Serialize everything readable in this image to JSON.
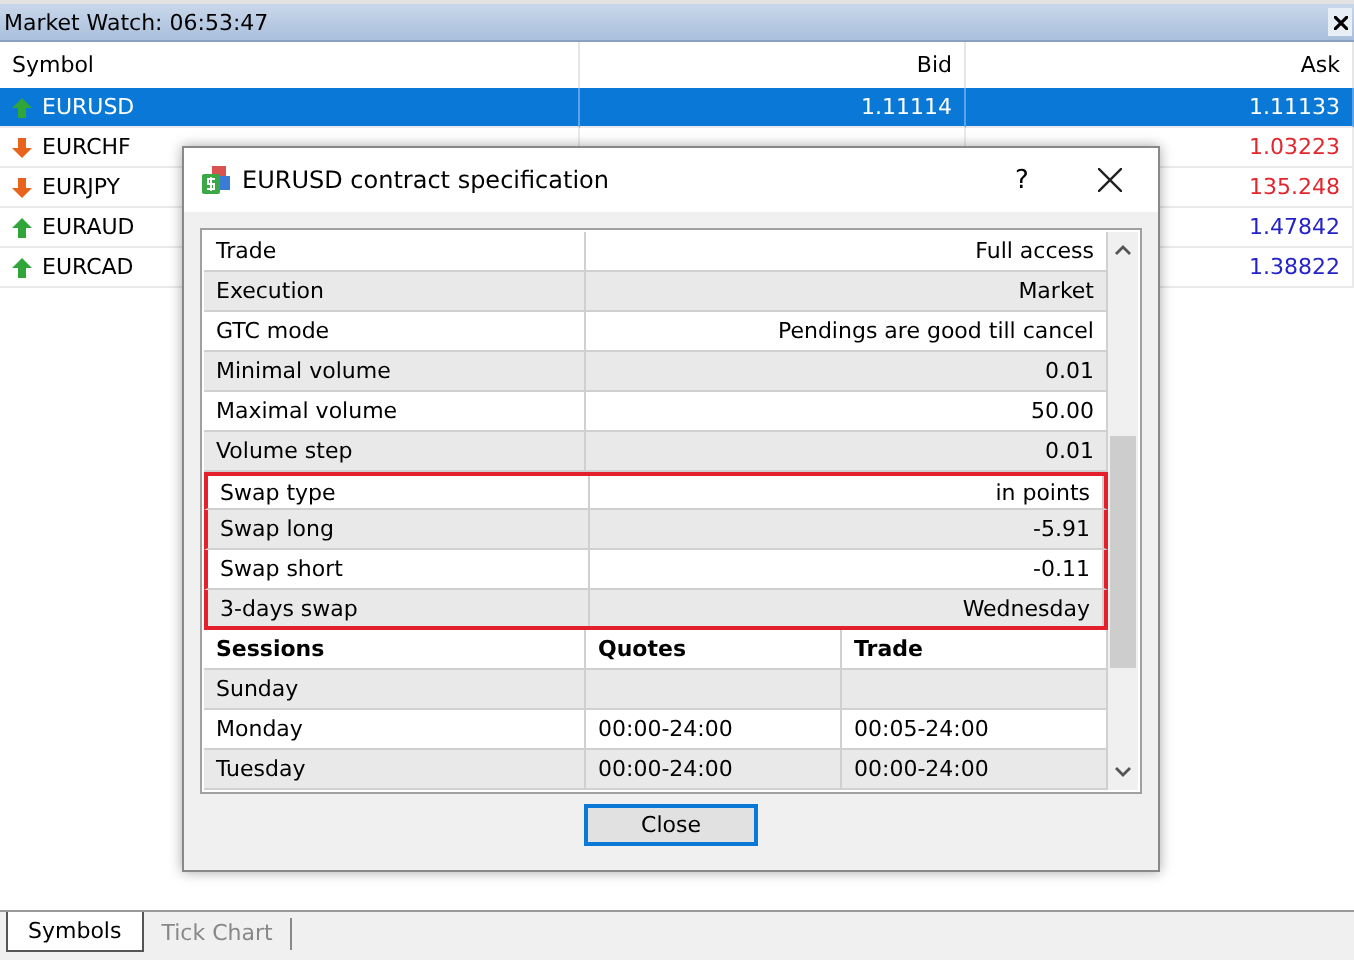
{
  "market_watch": {
    "title": "Market Watch: 06:53:47",
    "columns": [
      "Symbol",
      "Bid",
      "Ask"
    ],
    "rows": [
      {
        "symbol": "EURUSD",
        "kind": "up",
        "bid": "1.11114",
        "ask": "1.11133",
        "selected": true
      },
      {
        "symbol": "EURCHF",
        "kind": "down",
        "ask": "1.03223",
        "selected": false
      },
      {
        "symbol": "EURJPY",
        "kind": "down",
        "ask": "135.248",
        "selected": false
      },
      {
        "symbol": "EURAUD",
        "kind": "up",
        "ask": "1.47842",
        "selected": false
      },
      {
        "symbol": "EURCAD",
        "kind": "up",
        "ask": "1.38822",
        "selected": false
      }
    ],
    "tabs": [
      {
        "label": "Symbols",
        "selected": true
      },
      {
        "label": "Tick Chart",
        "selected": false
      }
    ]
  },
  "dialog": {
    "title": "EURUSD contract specification",
    "help": "?",
    "properties": [
      {
        "label": "Trade",
        "value": "Full access",
        "highlighted": false
      },
      {
        "label": "Execution",
        "value": "Market",
        "highlighted": false
      },
      {
        "label": "GTC mode",
        "value": "Pendings are good till cancel",
        "highlighted": false
      },
      {
        "label": "Minimal volume",
        "value": "0.01",
        "highlighted": false
      },
      {
        "label": "Maximal volume",
        "value": "50.00",
        "highlighted": false
      },
      {
        "label": "Volume step",
        "value": "0.01",
        "highlighted": false
      },
      {
        "label": "Swap type",
        "value": "in points",
        "highlighted": true
      },
      {
        "label": "Swap long",
        "value": "-5.91",
        "highlighted": true
      },
      {
        "label": "Swap short",
        "value": "-0.11",
        "highlighted": true
      },
      {
        "label": "3-days swap",
        "value": "Wednesday",
        "highlighted": true
      }
    ],
    "sessions": {
      "columns": [
        "Sessions",
        "Quotes",
        "Trade"
      ],
      "rows": [
        {
          "day": "Sunday"
        },
        {
          "day": "Monday",
          "quotes": "00:00-24:00",
          "trade": "00:05-24:00"
        },
        {
          "day": "Tuesday",
          "quotes": "00:00-24:00",
          "trade": "00:00-24:00"
        }
      ]
    },
    "button": "Close"
  }
}
